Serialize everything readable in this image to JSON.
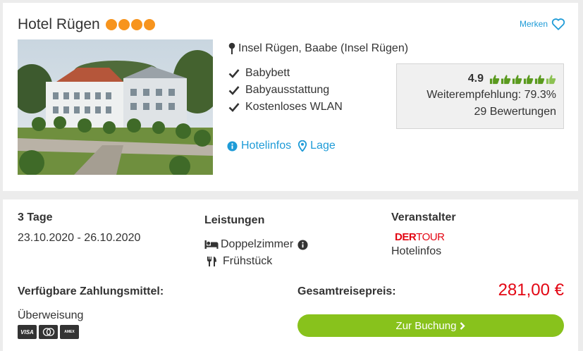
{
  "hotel": {
    "name": "Hotel Rügen",
    "stars": 4,
    "merken_label": "Merken",
    "location": "Insel Rügen, Baabe (Insel Rügen)",
    "amenities": [
      "Babybett",
      "Babyausstattung",
      "Kostenloses WLAN"
    ],
    "links": {
      "hotelinfos": "Hotelinfos",
      "lage": "Lage"
    }
  },
  "rating": {
    "score": "4.9",
    "thumbs": 6,
    "recommendation": "Weiterempfehlung: 79.3%",
    "reviews": "29 Bewertungen"
  },
  "offer": {
    "duration": "3 Tage",
    "dates": "23.10.2020 - 26.10.2020",
    "services_title": "Leistungen",
    "room": "Doppelzimmer",
    "board": "Frühstück",
    "operator_title": "Veranstalter",
    "operator_logo": {
      "der": "DER",
      "tour": "TOUR"
    },
    "operator_link": "Hotelinfos",
    "payment_title": "Verfügbare Zahlungsmittel:",
    "payment_method": "Überweisung",
    "payment_icons": [
      "VISA",
      "Mastercard",
      "American Express"
    ],
    "total_label": "Gesamtreisepreis:",
    "price": "281,00 €",
    "book_label": "Zur Buchung"
  },
  "colors": {
    "accent_blue": "#1e9bd7",
    "star_orange": "#f7941d",
    "price_red": "#e30613",
    "button_green": "#88c21c",
    "thumb_green": "#5a9a1e"
  }
}
